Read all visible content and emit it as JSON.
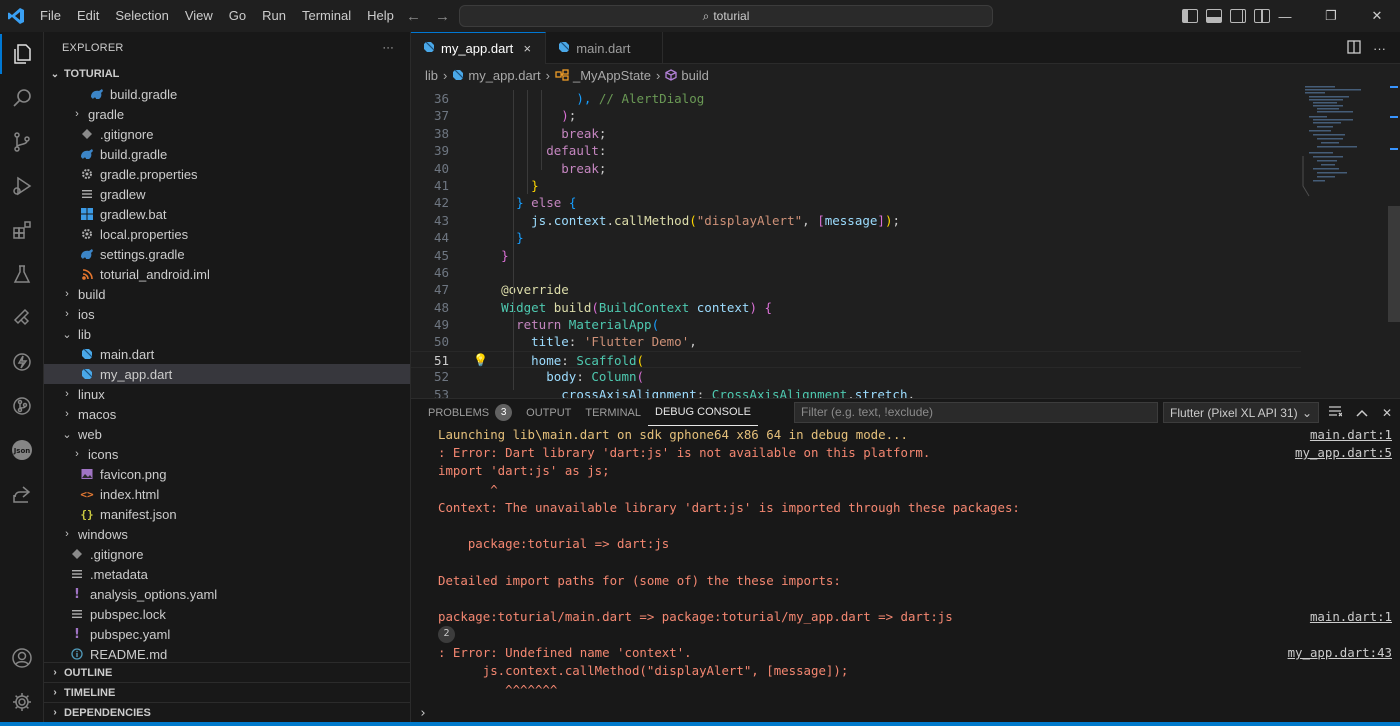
{
  "titlebar": {
    "menu": [
      "File",
      "Edit",
      "Selection",
      "View",
      "Go",
      "Run",
      "Terminal",
      "Help"
    ],
    "command_center": "toturial"
  },
  "sidebar": {
    "title": "EXPLORER",
    "more": "···",
    "root": "TOTURIAL",
    "tree": [
      {
        "label": "build.gradle",
        "indent": 2,
        "tw": "",
        "icon": "gradle-icon",
        "color": "#3c85c7"
      },
      {
        "label": "gradle",
        "indent": 1,
        "tw": "›",
        "icon": "",
        "color": ""
      },
      {
        "label": ".gitignore",
        "indent": 1,
        "tw": "",
        "icon": "git-icon",
        "color": "#8a8a8a"
      },
      {
        "label": "build.gradle",
        "indent": 1,
        "tw": "",
        "icon": "gradle-icon",
        "color": "#3c85c7"
      },
      {
        "label": "gradle.properties",
        "indent": 1,
        "tw": "",
        "icon": "gear-icon",
        "color": "#b0b0b0"
      },
      {
        "label": "gradlew",
        "indent": 1,
        "tw": "",
        "icon": "lines-icon",
        "color": "#b0b0b0"
      },
      {
        "label": "gradlew.bat",
        "indent": 1,
        "tw": "",
        "icon": "windows-icon",
        "color": "#3c9be6"
      },
      {
        "label": "local.properties",
        "indent": 1,
        "tw": "",
        "icon": "gear-icon",
        "color": "#b0b0b0"
      },
      {
        "label": "settings.gradle",
        "indent": 1,
        "tw": "",
        "icon": "gradle-icon",
        "color": "#3c85c7"
      },
      {
        "label": "toturial_android.iml",
        "indent": 1,
        "tw": "",
        "icon": "rss-icon",
        "color": "#e8772e"
      },
      {
        "label": "build",
        "indent": 0,
        "tw": "›",
        "icon": "",
        "color": ""
      },
      {
        "label": "ios",
        "indent": 0,
        "tw": "›",
        "icon": "",
        "color": ""
      },
      {
        "label": "lib",
        "indent": 0,
        "tw": "⌄",
        "icon": "",
        "color": ""
      },
      {
        "label": "main.dart",
        "indent": 1,
        "tw": "",
        "icon": "dart-icon",
        "color": "#4aa8e8"
      },
      {
        "label": "my_app.dart",
        "indent": 1,
        "tw": "",
        "icon": "dart-icon",
        "color": "#4aa8e8",
        "selected": true
      },
      {
        "label": "linux",
        "indent": 0,
        "tw": "›",
        "icon": "",
        "color": ""
      },
      {
        "label": "macos",
        "indent": 0,
        "tw": "›",
        "icon": "",
        "color": ""
      },
      {
        "label": "web",
        "indent": 0,
        "tw": "⌄",
        "icon": "",
        "color": ""
      },
      {
        "label": "icons",
        "indent": 1,
        "tw": "›",
        "icon": "",
        "color": ""
      },
      {
        "label": "favicon.png",
        "indent": 1,
        "tw": "",
        "icon": "image-icon",
        "color": "#a074c4"
      },
      {
        "label": "index.html",
        "indent": 1,
        "tw": "",
        "icon": "html-icon",
        "color": "#e37933"
      },
      {
        "label": "manifest.json",
        "indent": 1,
        "tw": "",
        "icon": "json-icon",
        "color": "#cbcb41"
      },
      {
        "label": "windows",
        "indent": 0,
        "tw": "›",
        "icon": "",
        "color": ""
      },
      {
        "label": ".gitignore",
        "indent": 0,
        "tw": "",
        "icon": "git-icon",
        "color": "#8a8a8a"
      },
      {
        "label": ".metadata",
        "indent": 0,
        "tw": "",
        "icon": "lines-icon",
        "color": "#b0b0b0"
      },
      {
        "label": "analysis_options.yaml",
        "indent": 0,
        "tw": "",
        "icon": "yaml-icon",
        "color": "#a074c4"
      },
      {
        "label": "pubspec.lock",
        "indent": 0,
        "tw": "",
        "icon": "lines-icon",
        "color": "#b0b0b0"
      },
      {
        "label": "pubspec.yaml",
        "indent": 0,
        "tw": "",
        "icon": "yaml-icon",
        "color": "#a074c4"
      },
      {
        "label": "README.md",
        "indent": 0,
        "tw": "",
        "icon": "info-icon",
        "color": "#519aba"
      }
    ],
    "sections": [
      "OUTLINE",
      "TIMELINE",
      "DEPENDENCIES"
    ]
  },
  "editor": {
    "tabs": [
      {
        "label": "my_app.dart",
        "active": true,
        "close": "×"
      },
      {
        "label": "main.dart",
        "active": false,
        "close": ""
      }
    ],
    "breadcrumb": [
      "lib",
      "my_app.dart",
      "_MyAppState",
      "build"
    ],
    "current_line": 51,
    "lines": [
      {
        "n": 36,
        "t": [
          [
            "            ",
            ""
          ],
          [
            "),",
            "c-b3"
          ],
          [
            " // AlertDialog",
            "c-com"
          ]
        ]
      },
      {
        "n": 37,
        "t": [
          [
            "          ",
            ""
          ],
          [
            ")",
            "c-b2"
          ],
          [
            ";",
            ""
          ]
        ]
      },
      {
        "n": 38,
        "t": [
          [
            "          ",
            ""
          ],
          [
            "break",
            "c-kw"
          ],
          [
            ";",
            ""
          ]
        ]
      },
      {
        "n": 39,
        "t": [
          [
            "        ",
            ""
          ],
          [
            "default",
            "c-kw"
          ],
          [
            ":",
            ""
          ]
        ]
      },
      {
        "n": 40,
        "t": [
          [
            "          ",
            ""
          ],
          [
            "break",
            "c-kw"
          ],
          [
            ";",
            ""
          ]
        ]
      },
      {
        "n": 41,
        "t": [
          [
            "      ",
            ""
          ],
          [
            "}",
            "c-b1"
          ]
        ]
      },
      {
        "n": 42,
        "t": [
          [
            "    ",
            ""
          ],
          [
            "}",
            "c-b3"
          ],
          [
            " ",
            ""
          ],
          [
            "else",
            "c-kw"
          ],
          [
            " ",
            ""
          ],
          [
            "{",
            "c-b3"
          ]
        ]
      },
      {
        "n": 43,
        "t": [
          [
            "      ",
            ""
          ],
          [
            "js",
            "c-var"
          ],
          [
            ".",
            ""
          ],
          [
            "context",
            "c-var"
          ],
          [
            ".",
            ""
          ],
          [
            "callMethod",
            "c-fn"
          ],
          [
            "(",
            "c-b1"
          ],
          [
            "\"displayAlert\"",
            "c-str"
          ],
          [
            ", ",
            ""
          ],
          [
            "[",
            "c-b2"
          ],
          [
            "message",
            "c-var"
          ],
          [
            "]",
            "c-b2"
          ],
          [
            ")",
            "c-b1"
          ],
          [
            ";",
            ""
          ]
        ]
      },
      {
        "n": 44,
        "t": [
          [
            "    ",
            ""
          ],
          [
            "}",
            "c-b3"
          ]
        ]
      },
      {
        "n": 45,
        "t": [
          [
            "  ",
            ""
          ],
          [
            "}",
            "c-b2"
          ]
        ]
      },
      {
        "n": 46,
        "t": [
          [
            "",
            ""
          ]
        ]
      },
      {
        "n": 47,
        "t": [
          [
            "  ",
            ""
          ],
          [
            "@override",
            "c-ann"
          ]
        ]
      },
      {
        "n": 48,
        "t": [
          [
            "  ",
            ""
          ],
          [
            "Widget",
            "c-ty"
          ],
          [
            " ",
            ""
          ],
          [
            "build",
            "c-fn"
          ],
          [
            "(",
            "c-b2"
          ],
          [
            "BuildContext",
            "c-ty"
          ],
          [
            " ",
            ""
          ],
          [
            "context",
            "c-var"
          ],
          [
            ")",
            "c-b2"
          ],
          [
            " ",
            ""
          ],
          [
            "{",
            "c-b2"
          ]
        ]
      },
      {
        "n": 49,
        "t": [
          [
            "    ",
            ""
          ],
          [
            "return",
            "c-kw"
          ],
          [
            " ",
            ""
          ],
          [
            "MaterialApp",
            "c-ty"
          ],
          [
            "(",
            "c-b3"
          ]
        ]
      },
      {
        "n": 50,
        "t": [
          [
            "      ",
            ""
          ],
          [
            "title",
            "c-var"
          ],
          [
            ": ",
            ""
          ],
          [
            "'Flutter Demo'",
            "c-str"
          ],
          [
            ",",
            ""
          ]
        ]
      },
      {
        "n": 51,
        "t": [
          [
            "      ",
            ""
          ],
          [
            "home",
            "c-var"
          ],
          [
            ": ",
            ""
          ],
          [
            "Scaffold",
            "c-ty"
          ],
          [
            "(",
            "c-b1"
          ]
        ]
      },
      {
        "n": 52,
        "t": [
          [
            "        ",
            ""
          ],
          [
            "body",
            "c-var"
          ],
          [
            ": ",
            ""
          ],
          [
            "Column",
            "c-ty"
          ],
          [
            "(",
            "c-b2"
          ]
        ]
      },
      {
        "n": 53,
        "t": [
          [
            "          ",
            ""
          ],
          [
            "crossAxisAlignment",
            "c-var"
          ],
          [
            ": ",
            ""
          ],
          [
            "CrossAxisAlignment",
            "c-ty"
          ],
          [
            ".",
            ""
          ],
          [
            "stretch",
            "c-var"
          ],
          [
            ",",
            ""
          ]
        ]
      }
    ]
  },
  "panel": {
    "tabs": [
      {
        "label": "PROBLEMS",
        "badge": "3",
        "active": false
      },
      {
        "label": "OUTPUT",
        "badge": "",
        "active": false
      },
      {
        "label": "TERMINAL",
        "badge": "",
        "active": false
      },
      {
        "label": "DEBUG CONSOLE",
        "badge": "",
        "active": true
      }
    ],
    "filter_placeholder": "Filter (e.g. text, !exclude)",
    "device": "Flutter (Pixel XL API 31)",
    "console": [
      {
        "text": "Launching lib\\main.dart on sdk gphone64 x86 64 in debug mode...",
        "cls": "ctext-y",
        "src": "main.dart:1"
      },
      {
        "text": ": Error: Dart library 'dart:js' is not available on this platform.",
        "cls": "ctext-w",
        "src": "my_app.dart:5"
      },
      {
        "text": "import 'dart:js' as js;",
        "cls": "ctext-w",
        "src": ""
      },
      {
        "text": "       ^",
        "cls": "ctext-w",
        "src": ""
      },
      {
        "text": "Context: The unavailable library 'dart:js' is imported through these packages:",
        "cls": "ctext-w",
        "src": ""
      },
      {
        "text": "",
        "cls": "ctext-w",
        "src": ""
      },
      {
        "text": "    package:toturial => dart:js",
        "cls": "ctext-w",
        "src": ""
      },
      {
        "text": "",
        "cls": "ctext-w",
        "src": ""
      },
      {
        "text": "Detailed import paths for (some of) the these imports:",
        "cls": "ctext-w",
        "src": ""
      },
      {
        "text": "",
        "cls": "ctext-w",
        "src": ""
      },
      {
        "text": "package:toturial/main.dart => package:toturial/my_app.dart => dart:js",
        "cls": "ctext-w",
        "src": "main.dart:1"
      },
      {
        "text": "",
        "cls": "ctext-w",
        "src": "",
        "badge": "2"
      },
      {
        "text": ": Error: Undefined name 'context'.",
        "cls": "ctext-w",
        "src": "my_app.dart:43"
      },
      {
        "text": "      js.context.callMethod(\"displayAlert\", [message]);",
        "cls": "ctext-w",
        "src": ""
      },
      {
        "text": "         ^^^^^^^",
        "cls": "ctext-w",
        "src": ""
      }
    ],
    "prompt": "›"
  }
}
